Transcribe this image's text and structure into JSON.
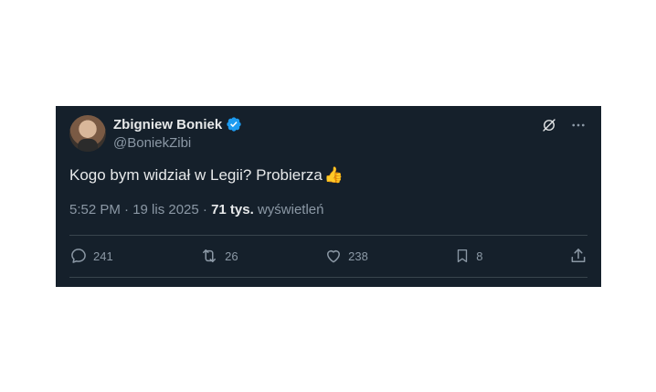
{
  "author": {
    "name": "Zbigniew Boniek",
    "handle": "@BoniekZibi"
  },
  "tweet": {
    "text": "Kogo bym widział w Legii? Probierza",
    "emoji": "👍"
  },
  "meta": {
    "time_date": "5:52 PM · 19 lis 2025 · ",
    "views_count": "71 tys.",
    "views_label": "wyświetleń"
  },
  "actions": {
    "replies": "241",
    "reposts": "26",
    "likes": "238",
    "bookmarks": "8"
  },
  "colors": {
    "background": "#15202b",
    "text": "#e7e9ea",
    "secondary": "#8b98a5",
    "verified": "#1d9bf0",
    "divider": "#38444d"
  }
}
